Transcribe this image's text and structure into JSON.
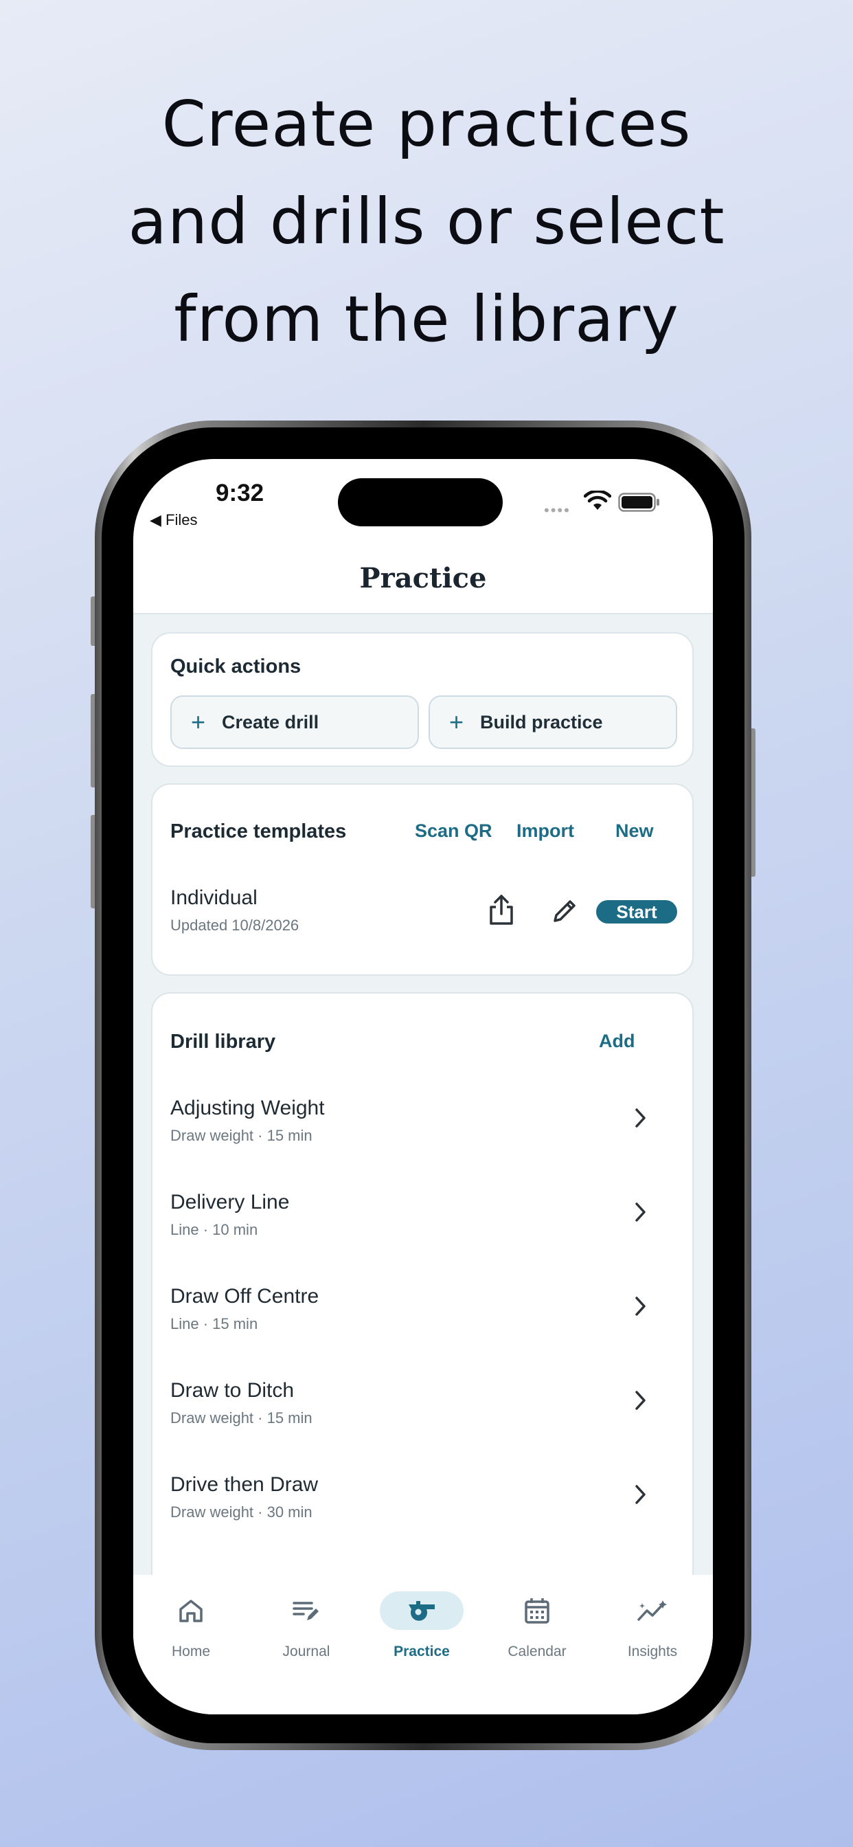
{
  "headline": [
    "Create practices",
    "and drills or select",
    "from the library"
  ],
  "status": {
    "time": "9:32",
    "back_label": "◀ Files"
  },
  "nav": {
    "title": "Practice"
  },
  "quick_actions": {
    "title": "Quick actions",
    "buttons": [
      {
        "icon": "plus-icon",
        "label": "Create drill"
      },
      {
        "icon": "plus-icon",
        "label": "Build practice"
      }
    ]
  },
  "practice_templates": {
    "title": "Practice templates",
    "actions": [
      "Scan QR",
      "Import",
      "New"
    ],
    "items": [
      {
        "name": "Individual",
        "updated": "Updated 10/8/2026",
        "share_icon": "share-icon",
        "edit_icon": "pencil-icon",
        "start_label": "Start"
      }
    ]
  },
  "drill_library": {
    "title": "Drill library",
    "add_label": "Add",
    "items": [
      {
        "name": "Adjusting Weight",
        "meta": "Draw weight · 15 min"
      },
      {
        "name": "Delivery Line",
        "meta": "Line · 10 min"
      },
      {
        "name": "Draw Off Centre",
        "meta": "Line · 15 min"
      },
      {
        "name": "Draw to Ditch",
        "meta": "Draw weight · 15 min"
      },
      {
        "name": "Drive then Draw",
        "meta": "Draw weight · 30 min"
      }
    ]
  },
  "tabbar": {
    "active": "Practice",
    "tabs": [
      {
        "label": "Home",
        "icon": "home-icon"
      },
      {
        "label": "Journal",
        "icon": "journal-icon"
      },
      {
        "label": "Practice",
        "icon": "whistle-icon"
      },
      {
        "label": "Calendar",
        "icon": "calendar-icon"
      },
      {
        "label": "Insights",
        "icon": "insights-icon"
      }
    ]
  },
  "colors": {
    "accent": "#1d6c86",
    "background": "#edf2f4",
    "text": "#1f2a33",
    "muted": "#6b7780"
  }
}
